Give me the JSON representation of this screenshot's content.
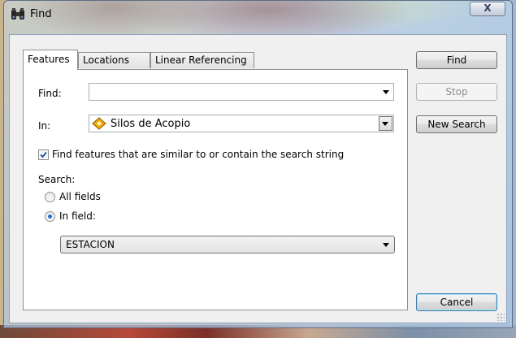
{
  "window": {
    "title": "Find",
    "close_glyph": "X"
  },
  "tabs": [
    {
      "label": "Features",
      "active": true
    },
    {
      "label": "Locations",
      "active": false
    },
    {
      "label": "Linear Referencing",
      "active": false
    }
  ],
  "form": {
    "find_label": "Find:",
    "find_value": "",
    "in_label": "In:",
    "in_value": "Silos de Acopio",
    "similar_label": "Find features that are similar to or contain the search string",
    "similar_checked": true,
    "search_label": "Search:",
    "all_fields_label": "All fields",
    "in_field_label": "In field:",
    "selected_search_option": "In field:",
    "field_value": "ESTACION"
  },
  "buttons": {
    "find": "Find",
    "stop": "Stop",
    "new_search": "New Search",
    "cancel": "Cancel"
  },
  "colors": {
    "accent_radio": "#1e6fd0",
    "layer_icon": "#f0a800"
  },
  "icons": {
    "title": "binoculars-icon",
    "layer": "layer-symbol-icon"
  }
}
